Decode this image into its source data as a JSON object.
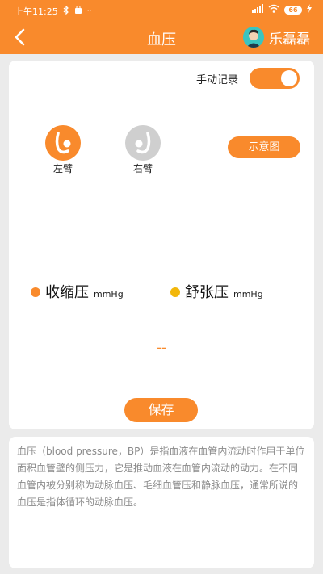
{
  "statusbar": {
    "time": "上午11:25",
    "left_icons": [
      "bluetooth-icon",
      "bag-icon",
      "more-dots-icon"
    ],
    "right_icons": [
      "signal-icon",
      "wifi-icon",
      "battery-icon",
      "charging-icon"
    ],
    "battery_level": "66",
    "color": "#f98a2c"
  },
  "navbar": {
    "title": "血压",
    "user_name": "乐磊磊",
    "accent": "#f98a2c"
  },
  "manual_record": {
    "label": "手动记录",
    "enabled": true
  },
  "arms": [
    {
      "label": "左臂",
      "selected": true,
      "icon": "left-arm-icon"
    },
    {
      "label": "右臂",
      "selected": false,
      "icon": "right-arm-icon"
    }
  ],
  "diagram_button": "示意图",
  "systolic": {
    "label": "收缩压",
    "unit": "mmHg",
    "dot_color": "#f98a2c",
    "value": ""
  },
  "diastolic": {
    "label": "舒张压",
    "unit": "mmHg",
    "dot_color": "#f2b70a",
    "value": ""
  },
  "result_placeholder": "--",
  "save_button": "保存",
  "description": "血压（blood pressure，BP）是指血液在血管内流动时作用于单位面积血管壁的侧压力，它是推动血液在血管内流动的动力。在不同血管内被分别称为动脉血压、毛细血管压和静脉血压，通常所说的血压是指体循环的动脉血压。"
}
